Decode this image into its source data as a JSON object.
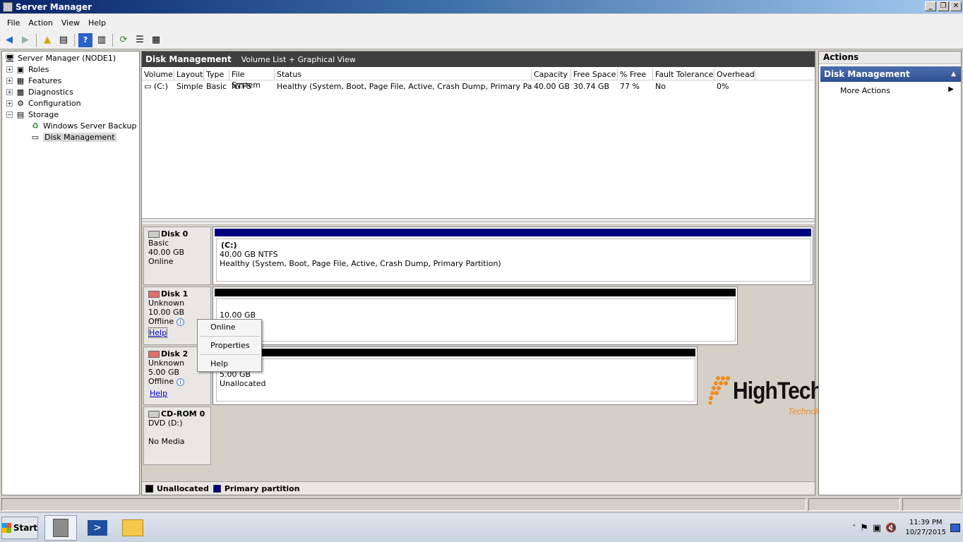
{
  "window": {
    "title": "Server Manager"
  },
  "menu": [
    "File",
    "Action",
    "View",
    "Help"
  ],
  "tree": {
    "root": "Server Manager (NODE1)",
    "roles": "Roles",
    "features": "Features",
    "diagnostics": "Diagnostics",
    "configuration": "Configuration",
    "storage": "Storage",
    "backup": "Windows Server Backup",
    "disk_mgmt": "Disk Management"
  },
  "center": {
    "title": "Disk Management",
    "view_label": "Volume List + Graphical View",
    "columns": [
      "Volume",
      "Layout",
      "Type",
      "File System",
      "Status",
      "Capacity",
      "Free Space",
      "% Free",
      "Fault Tolerance",
      "Overhead"
    ],
    "rows": [
      [
        "(C:)",
        "Simple",
        "Basic",
        "NTFS",
        "Healthy (System, Boot, Page File, Active, Crash Dump, Primary Partition)",
        "40.00 GB",
        "30.74 GB",
        "77 %",
        "No",
        "0%"
      ]
    ]
  },
  "disks": [
    {
      "name": "Disk 0",
      "type": "Basic",
      "size": "40.00 GB",
      "status": "Online",
      "part_label": "(C:)",
      "part_size": "40.00 GB NTFS",
      "part_status": "Healthy (System, Boot, Page File, Active, Crash Dump, Primary Partition)"
    },
    {
      "name": "Disk 1",
      "type": "Unknown",
      "size": "10.00 GB",
      "status": "Offline",
      "help": "Help",
      "part_size": "10.00 GB"
    },
    {
      "name": "Disk 2",
      "type": "Unknown",
      "size": "5.00 GB",
      "status": "Offline",
      "help": "Help",
      "part_size": "5.00 GB",
      "part_status": "Unallocated"
    },
    {
      "name": "CD-ROM 0",
      "type": "DVD (D:)",
      "status": "No Media"
    }
  ],
  "context_menu": [
    "Online",
    "Properties",
    "Help"
  ],
  "legend": {
    "unallocated": "Unallocated",
    "primary": "Primary partition",
    "unallocated_color": "#000000",
    "primary_color": "#000080"
  },
  "actions": {
    "header": "Actions",
    "section": "Disk Management",
    "more": "More Actions"
  },
  "watermark": {
    "brand": "HighTechnology",
    "tagline": "Technology that teach you"
  },
  "taskbar": {
    "start": "Start",
    "time": "11:39 PM",
    "date": "10/27/2015"
  }
}
